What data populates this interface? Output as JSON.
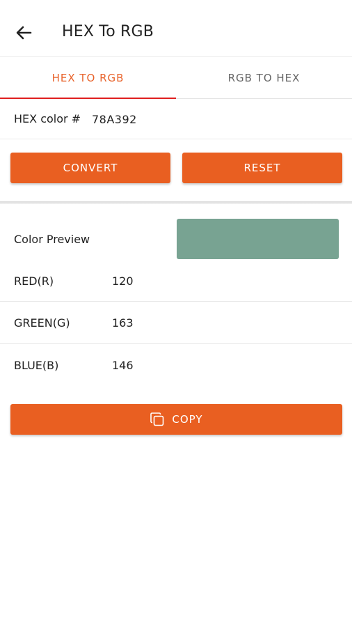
{
  "appbar": {
    "title": "HEX To RGB",
    "back_icon": "arrow-left-icon"
  },
  "tabs": [
    {
      "label": "HEX TO RGB",
      "active": true
    },
    {
      "label": "RGB TO HEX",
      "active": false
    }
  ],
  "hex": {
    "label": "HEX color #",
    "value": "78A392"
  },
  "buttons": {
    "convert": "CONVERT",
    "reset": "RESET",
    "copy": "COPY",
    "copy_icon": "copy-icon"
  },
  "preview": {
    "label": "Color Preview",
    "color": "#78A392"
  },
  "rgb": [
    {
      "label": "RED(R)",
      "value": "120"
    },
    {
      "label": "GREEN(G)",
      "value": "163"
    },
    {
      "label": "BLUE(B)",
      "value": "146"
    }
  ],
  "colors": {
    "accent": "#e95f21",
    "tab_active": "#e8622a",
    "indicator": "#e01f1f"
  }
}
